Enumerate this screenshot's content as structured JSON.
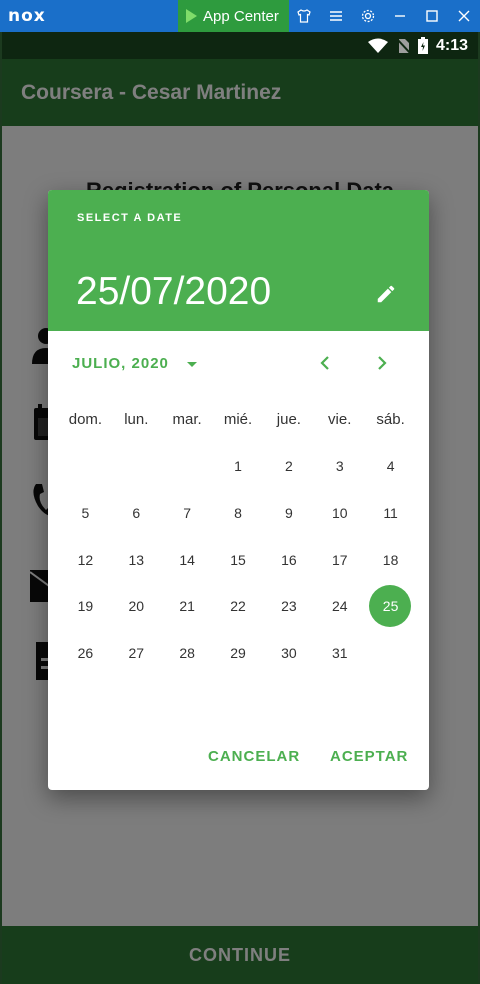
{
  "emulator": {
    "logo": "nox",
    "app_center": "App Center",
    "icons": [
      "shirt-icon",
      "menu-icon",
      "settings-icon",
      "minimize-icon",
      "maximize-icon",
      "close-icon"
    ]
  },
  "status_bar": {
    "time": "4:13",
    "icons": [
      "wifi-icon",
      "no-sim-icon",
      "battery-icon"
    ]
  },
  "app_bar": {
    "title": "Coursera - Cesar Martinez"
  },
  "page": {
    "title": "Registration of Personal Data",
    "field_icons": [
      "person-icon",
      "calendar-icon",
      "phone-icon",
      "email-icon",
      "description-icon"
    ],
    "continue_label": "CONTINUE"
  },
  "dialog": {
    "header_label": "SELECT A DATE",
    "selected_date": "25/07/2020",
    "month_label": "JULIO, 2020",
    "weekdays": [
      "dom.",
      "lun.",
      "mar.",
      "mié.",
      "jue.",
      "vie.",
      "sáb."
    ],
    "weeks": [
      [
        "",
        "",
        "",
        "1",
        "2",
        "3",
        "4"
      ],
      [
        "5",
        "6",
        "7",
        "8",
        "9",
        "10",
        "11"
      ],
      [
        "12",
        "13",
        "14",
        "15",
        "16",
        "17",
        "18"
      ],
      [
        "19",
        "20",
        "21",
        "22",
        "23",
        "24",
        "25"
      ],
      [
        "26",
        "27",
        "28",
        "29",
        "30",
        "31",
        ""
      ]
    ],
    "selected_day": "25",
    "cancel_label": "CANCELAR",
    "ok_label": "ACEPTAR"
  },
  "colors": {
    "accent": "#4caf50",
    "appbar": "#2f7a36",
    "emulator_bar": "#1a6fc9"
  }
}
